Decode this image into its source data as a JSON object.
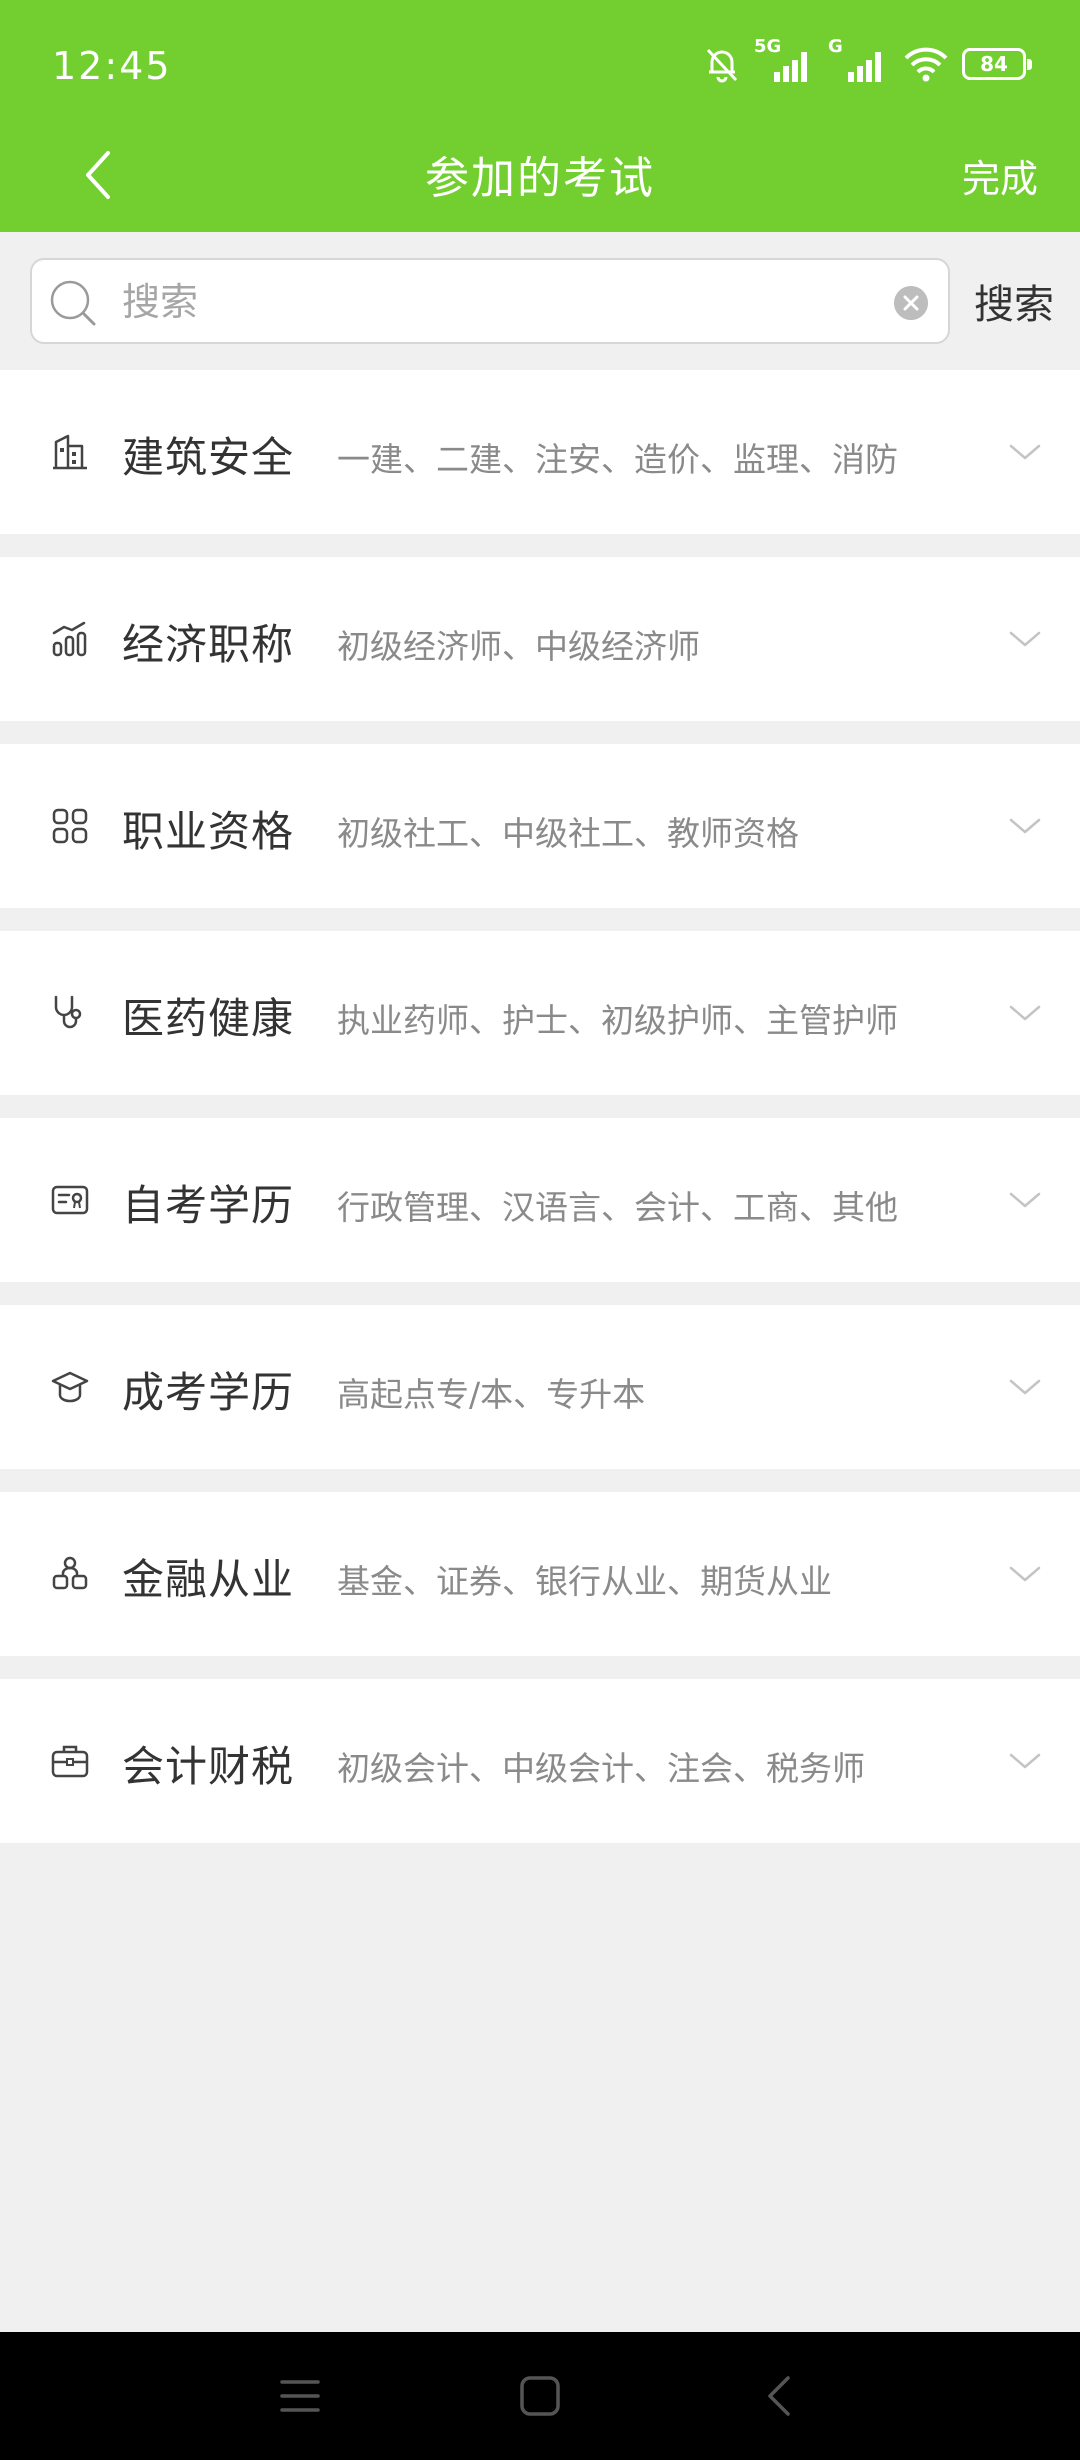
{
  "status_bar": {
    "time": "12:45",
    "signal_1_label": "5G",
    "signal_2_label": "G",
    "battery": "84",
    "icons": [
      "mute-bell-icon",
      "signal-icon",
      "signal-icon",
      "wifi-icon",
      "battery-icon"
    ]
  },
  "title_bar": {
    "title": "参加的考试",
    "done_label": "完成",
    "back_icon": "chevron-left-icon"
  },
  "search": {
    "placeholder": "搜索",
    "value": "",
    "button_label": "搜索"
  },
  "categories": [
    {
      "title": "建筑安全",
      "subtitle": "一建、二建、注安、造价、监理、消防",
      "icon": "building-icon"
    },
    {
      "title": "经济职称",
      "subtitle": "初级经济师、中级经济师",
      "icon": "bar-chart-icon"
    },
    {
      "title": "职业资格",
      "subtitle": "初级社工、中级社工、教师资格",
      "icon": "grid-icon"
    },
    {
      "title": "医药健康",
      "subtitle": "执业药师、护士、初级护师、主管护师",
      "icon": "stethoscope-icon"
    },
    {
      "title": "自考学历",
      "subtitle": "行政管理、汉语言、会计、工商、其他",
      "icon": "certificate-icon"
    },
    {
      "title": "成考学历",
      "subtitle": "高起点专/本、专升本",
      "icon": "graduation-cap-icon"
    },
    {
      "title": "金融从业",
      "subtitle": "基金、证券、银行从业、期货从业",
      "icon": "people-icon"
    },
    {
      "title": "会计财税",
      "subtitle": "初级会计、中级会计、注会、税务师",
      "icon": "briefcase-icon"
    }
  ],
  "colors": {
    "brand_green": "#72cf2f",
    "background": "#f0f0f0",
    "title_text": "#333333",
    "subtitle_text": "#8a8a8a"
  }
}
